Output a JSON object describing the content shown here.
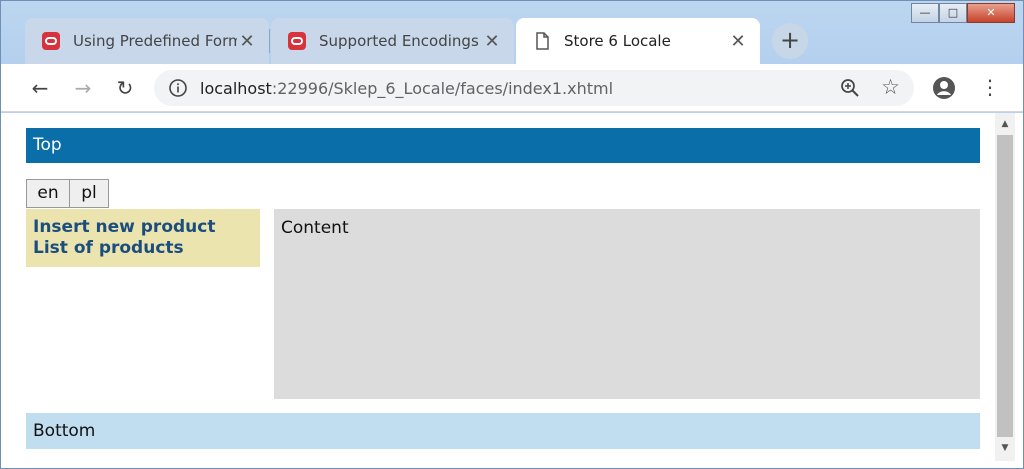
{
  "browser": {
    "tabs": [
      {
        "title": "Using Predefined Form",
        "close": "✕"
      },
      {
        "title": "Supported Encodings",
        "close": "✕"
      },
      {
        "title": "Store 6 Locale",
        "close": "✕"
      }
    ],
    "new_tab": "+",
    "url_host": "localhost",
    "url_rest": ":22996/Sklep_6_Locale/faces/index1.xhtml",
    "nav": {
      "back": "←",
      "forward": "→",
      "reload": "↻"
    },
    "menu_glyph": "⋮",
    "star_glyph": "☆",
    "window_controls": {
      "minimize": "—",
      "maximize": "□",
      "close": "✕"
    }
  },
  "page": {
    "top": "Top",
    "languages": [
      "en",
      "pl"
    ],
    "menu_links": [
      "Insert new product",
      "List of products"
    ],
    "content": "Content",
    "bottom": "Bottom"
  },
  "colors": {
    "top_bar": "#0a6ea9",
    "menu_bg": "#ebe4ae",
    "content_bg": "#dcdcdc",
    "bottom_bg": "#c1ddf0",
    "link": "#1b4e7f",
    "oracle_icon": "#d8323c"
  },
  "scrollbar": {
    "up": "▲",
    "down": "▼"
  }
}
